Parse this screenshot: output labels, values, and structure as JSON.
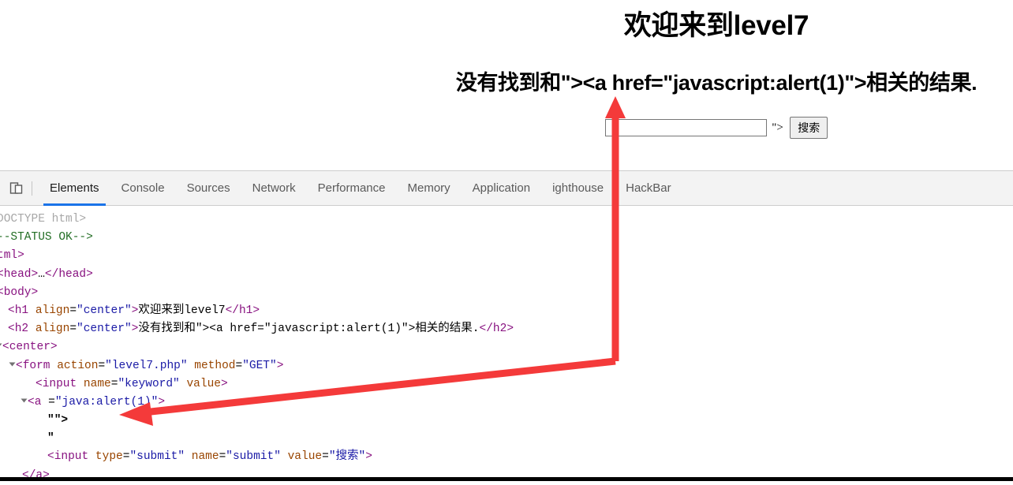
{
  "page": {
    "h1": "欢迎来到level7",
    "h2": "没有找到和\"><a href=\"javascript:alert(1)\">相关的结果.",
    "input_value": "",
    "stray_text": "\">",
    "submit_label": "搜索"
  },
  "devtools": {
    "device_toggle_icon": "device-toolbar-icon",
    "tabs": [
      {
        "label": "Elements",
        "active": true
      },
      {
        "label": "Console",
        "active": false
      },
      {
        "label": "Sources",
        "active": false
      },
      {
        "label": "Network",
        "active": false
      },
      {
        "label": "Performance",
        "active": false
      },
      {
        "label": "Memory",
        "active": false
      },
      {
        "label": "Application",
        "active": false
      },
      {
        "label": "ighthouse",
        "active": false
      },
      {
        "label": "HackBar",
        "active": false
      }
    ],
    "active_tab_accent": "#1a73e8",
    "dom_lines": [
      {
        "id": "l0",
        "text": "DOCTYPE html>"
      },
      {
        "id": "l1",
        "text": "--STATUS OK-->"
      },
      {
        "id": "l2",
        "text": "tml>"
      },
      {
        "id": "l3",
        "text": "<head>…</head>"
      },
      {
        "id": "l4",
        "text": "<body>"
      },
      {
        "id": "l5",
        "tag": "h1",
        "attr": "align",
        "value": "\"center\"",
        "text": "欢迎来到level7",
        "close": "</h1>"
      },
      {
        "id": "l6",
        "tag": "h2",
        "attr": "align",
        "value": "\"center\"",
        "text": "没有找到和\"><a href=\"javascript:alert(1)\">相关的结果.",
        "close": "</h2>"
      },
      {
        "id": "l7",
        "text": "<center>"
      },
      {
        "id": "l8",
        "text": "<form action=\"level7.php\" method=\"GET\">"
      },
      {
        "id": "l9",
        "text": "<input name=\"keyword\" value>"
      },
      {
        "id": "l10",
        "text": "<a =\"java:alert(1)\">"
      },
      {
        "id": "l11",
        "text": "\"\">"
      },
      {
        "id": "l12",
        "text": "\""
      },
      {
        "id": "l13",
        "text": "<input type=\"submit\" name=\"submit\" value=\"搜索\">"
      },
      {
        "id": "l14",
        "text": "</a>"
      }
    ],
    "dom_text": {
      "doctype": "DOCTYPE html>",
      "status_comment": "--STATUS OK-->",
      "html_tag": "tml>",
      "head_open": "<head>",
      "head_ellipsis": "…",
      "head_close": "</head>",
      "body_open": "<body>",
      "h1_open": "<h1",
      "h1_attr": "align",
      "h1_eq": "=",
      "h1_val": "\"center\"",
      "h1_gt": ">",
      "h1_text": "欢迎来到level7",
      "h1_close": "</h1>",
      "h2_open": "<h2",
      "h2_attr": "align",
      "h2_eq": "=",
      "h2_val": "\"center\"",
      "h2_gt": ">",
      "h2_text": "没有找到和\"><a href=\"javascript:alert(1)\">相关的结果.",
      "h2_close": "</h2>",
      "center_open": "<center>",
      "form_open": "<form",
      "form_attr1": "action",
      "form_val1": "\"level7.php\"",
      "form_attr2": "method",
      "form_val2": "\"GET\"",
      "form_gt": ">",
      "input1_open": "<input",
      "input1_attr1": "name",
      "input1_val1": "\"keyword\"",
      "input1_attr2": "value",
      "input1_gt": ">",
      "a_open": "<a",
      "a_eq": "=",
      "a_val": "\"java:alert(1)\"",
      "a_gt": ">",
      "quote_line": "\"\">",
      "quote_line2": "\"",
      "input2_open": "<input",
      "input2_attr1": "type",
      "input2_val1": "\"submit\"",
      "input2_attr2": "name",
      "input2_val2": "\"submit\"",
      "input2_attr3": "value",
      "input2_val3": "\"搜索\"",
      "input2_gt": ">",
      "a_close": "</a>"
    }
  },
  "annotations": {
    "arrow_color": "#f43a3a",
    "vertical_arrow": "points up from DOM tree to search input",
    "diagonal_arrow": "points from search input area to anchor tag line"
  }
}
